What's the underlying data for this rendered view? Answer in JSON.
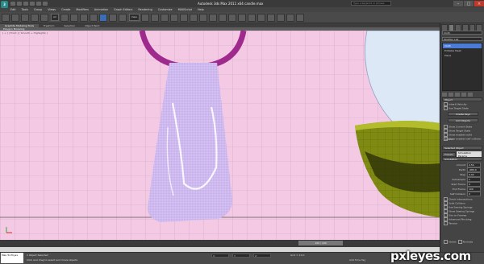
{
  "app": {
    "title": "Autodesk 3ds Max 2011 x64   candle.max",
    "logo": "3",
    "search_placeholder": "Type a keyword or phrase"
  },
  "menu": [
    "Edit",
    "Tools",
    "Group",
    "Views",
    "Create",
    "Modifiers",
    "Animation",
    "Graph Editors",
    "Rendering",
    "Customize",
    "MAXScript",
    "Help"
  ],
  "toolbar": {
    "selection_filter": "All",
    "reference_coord": "View"
  },
  "ribbon": {
    "tabs": [
      "Graphite Modeling Tools",
      "Freeform",
      "Selection",
      "Object Paint"
    ],
    "active_tab": 0,
    "sub_label": "Polygon Modeling"
  },
  "viewport": {
    "label": "[ + ] [ Front ] [ Smooth + Highlights ]",
    "background": "#f4c9e4",
    "ring_color": "#9e2a8e",
    "cloth_color": "#d8c5f5",
    "bowl_color": "#7f8a12"
  },
  "time": {
    "frame_label": "100 / 100"
  },
  "status": {
    "listener": "Max To Physx",
    "line1": "1 Object Selected",
    "line2": "Click and drag to select and move objects",
    "grid": "Grid = 10,0",
    "add_time_tag": "Add Time Tag"
  },
  "watermark": "pxleyes.com",
  "command_panel": {
    "object_name": "Cloth",
    "modifier_list": "Modifier List",
    "stack": [
      "Cloth",
      "Editable Mesh",
      "Plane"
    ],
    "stack_selected": 0,
    "rollouts": {
      "object": "Object",
      "selected_object": "Selected Object",
      "simulation": "Simulation"
    },
    "object_checks": [
      "Inherit Velocity",
      "Use Target State"
    ],
    "object_buttons": [
      "Create Keys",
      "Add Objects"
    ],
    "sim_checks": [
      "Show Current State",
      "Show Target State",
      "Show enabled solid collision",
      "Show enabled self collision"
    ],
    "tabs": [
      "Presets",
      "Simulation Params"
    ],
    "params": [
      {
        "label": "cm/unit",
        "value": "2,54"
      },
      {
        "label": "Earth",
        "value": "-980,0"
      },
      {
        "label": "Step",
        "value": "0,02"
      },
      {
        "label": "Subsample",
        "value": "1"
      },
      {
        "label": "Start Frame",
        "value": "0"
      },
      {
        "label": "End Frame",
        "value": "100"
      },
      {
        "label": "Self Collision",
        "value": "0"
      }
    ],
    "param_checks": [
      "Check Intersections",
      "Solid Collision",
      "Use Sewing Springs",
      "Show Sewing Springs",
      "Sim on Frames",
      "Advanced Pinching",
      "Tension"
    ],
    "bottom_checks": [
      "Vertex",
      "Normals"
    ]
  }
}
